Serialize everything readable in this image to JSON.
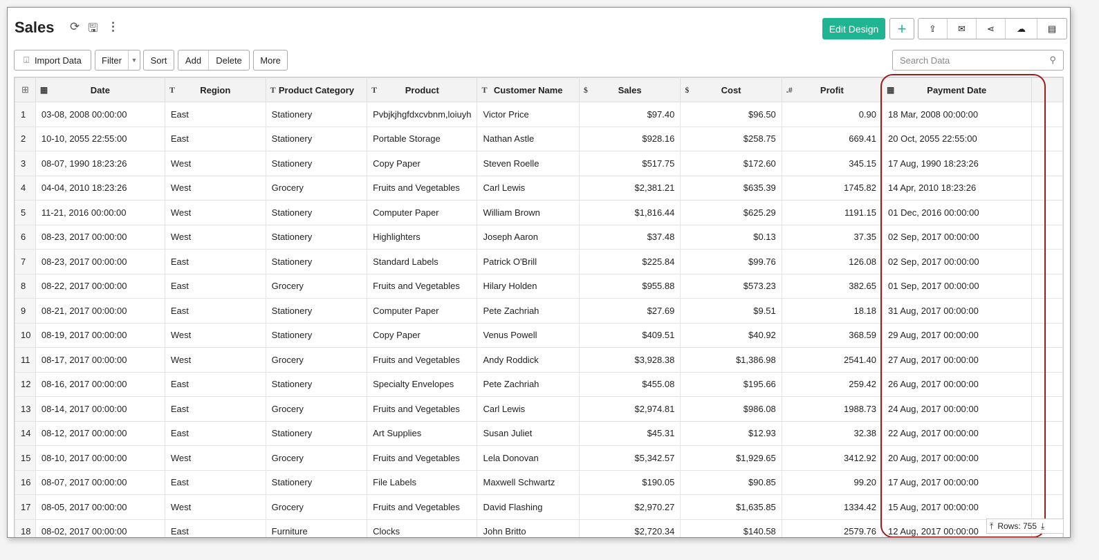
{
  "header": {
    "title": "Sales",
    "edit_design": "Edit Design",
    "icons": [
      "refresh-icon",
      "save-icon",
      "more-vertical-icon",
      "plus-icon",
      "export-icon",
      "email-icon",
      "share-icon",
      "cloud-upload-icon",
      "comment-icon"
    ]
  },
  "toolbar": {
    "import": "Import Data",
    "filter": "Filter",
    "sort": "Sort",
    "add": "Add",
    "delete": "Delete",
    "more": "More",
    "search_placeholder": "Search Data"
  },
  "accent": "#1fb592",
  "highlight_color": "#9b1c1c",
  "columns": [
    {
      "label": "Date",
      "type": "date"
    },
    {
      "label": "Region",
      "type": "T"
    },
    {
      "label": "Product Category",
      "type": "T"
    },
    {
      "label": "Product",
      "type": "T"
    },
    {
      "label": "Customer Name",
      "type": "T"
    },
    {
      "label": "Sales",
      "type": "currency"
    },
    {
      "label": "Cost",
      "type": "currency"
    },
    {
      "label": "Profit",
      "type": ".#"
    },
    {
      "label": "Payment Date",
      "type": "date"
    }
  ],
  "rows": [
    [
      "03-08, 2008 00:00:00",
      "East",
      "Stationery",
      "Pvbjkjhgfdxcvbnm,loiuyh",
      "Victor Price",
      "$97.40",
      "$96.50",
      "0.90",
      "18 Mar, 2008 00:00:00"
    ],
    [
      "10-10, 2055 22:55:00",
      "East",
      "Stationery",
      "Portable Storage",
      "Nathan Astle",
      "$928.16",
      "$258.75",
      "669.41",
      "20 Oct, 2055 22:55:00"
    ],
    [
      "08-07, 1990 18:23:26",
      "West",
      "Stationery",
      "Copy Paper",
      "Steven Roelle",
      "$517.75",
      "$172.60",
      "345.15",
      "17 Aug, 1990 18:23:26"
    ],
    [
      "04-04, 2010 18:23:26",
      "West",
      "Grocery",
      "Fruits and Vegetables",
      "Carl Lewis",
      "$2,381.21",
      "$635.39",
      "1745.82",
      "14 Apr, 2010 18:23:26"
    ],
    [
      "11-21, 2016 00:00:00",
      "West",
      "Stationery",
      "Computer Paper",
      "William Brown",
      "$1,816.44",
      "$625.29",
      "1191.15",
      "01 Dec, 2016 00:00:00"
    ],
    [
      "08-23, 2017 00:00:00",
      "West",
      "Stationery",
      "Highlighters",
      "Joseph Aaron",
      "$37.48",
      "$0.13",
      "37.35",
      "02 Sep, 2017 00:00:00"
    ],
    [
      "08-23, 2017 00:00:00",
      "East",
      "Stationery",
      "Standard Labels",
      "Patrick O'Brill",
      "$225.84",
      "$99.76",
      "126.08",
      "02 Sep, 2017 00:00:00"
    ],
    [
      "08-22, 2017 00:00:00",
      "East",
      "Grocery",
      "Fruits and Vegetables",
      "Hilary Holden",
      "$955.88",
      "$573.23",
      "382.65",
      "01 Sep, 2017 00:00:00"
    ],
    [
      "08-21, 2017 00:00:00",
      "East",
      "Stationery",
      "Computer Paper",
      "Pete Zachriah",
      "$27.69",
      "$9.51",
      "18.18",
      "31 Aug, 2017 00:00:00"
    ],
    [
      "08-19, 2017 00:00:00",
      "West",
      "Stationery",
      "Copy Paper",
      "Venus Powell",
      "$409.51",
      "$40.92",
      "368.59",
      "29 Aug, 2017 00:00:00"
    ],
    [
      "08-17, 2017 00:00:00",
      "West",
      "Grocery",
      "Fruits and Vegetables",
      "Andy Roddick",
      "$3,928.38",
      "$1,386.98",
      "2541.40",
      "27 Aug, 2017 00:00:00"
    ],
    [
      "08-16, 2017 00:00:00",
      "East",
      "Stationery",
      "Specialty Envelopes",
      "Pete Zachriah",
      "$455.08",
      "$195.66",
      "259.42",
      "26 Aug, 2017 00:00:00"
    ],
    [
      "08-14, 2017 00:00:00",
      "East",
      "Grocery",
      "Fruits and Vegetables",
      "Carl Lewis",
      "$2,974.81",
      "$986.08",
      "1988.73",
      "24 Aug, 2017 00:00:00"
    ],
    [
      "08-12, 2017 00:00:00",
      "East",
      "Stationery",
      "Art Supplies",
      "Susan Juliet",
      "$45.31",
      "$12.93",
      "32.38",
      "22 Aug, 2017 00:00:00"
    ],
    [
      "08-10, 2017 00:00:00",
      "West",
      "Grocery",
      "Fruits and Vegetables",
      "Lela Donovan",
      "$5,342.57",
      "$1,929.65",
      "3412.92",
      "20 Aug, 2017 00:00:00"
    ],
    [
      "08-07, 2017 00:00:00",
      "East",
      "Stationery",
      "File Labels",
      "Maxwell Schwartz",
      "$190.05",
      "$90.85",
      "99.20",
      "17 Aug, 2017 00:00:00"
    ],
    [
      "08-05, 2017 00:00:00",
      "West",
      "Grocery",
      "Fruits and Vegetables",
      "David Flashing",
      "$2,970.27",
      "$1,635.85",
      "1334.42",
      "15 Aug, 2017 00:00:00"
    ],
    [
      "08-02, 2017 00:00:00",
      "East",
      "Furniture",
      "Clocks",
      "John Britto",
      "$2,720.34",
      "$140.58",
      "2579.76",
      "12 Aug, 2017 00:00:00"
    ]
  ],
  "footer": {
    "rows_label": "Rows: 755"
  }
}
